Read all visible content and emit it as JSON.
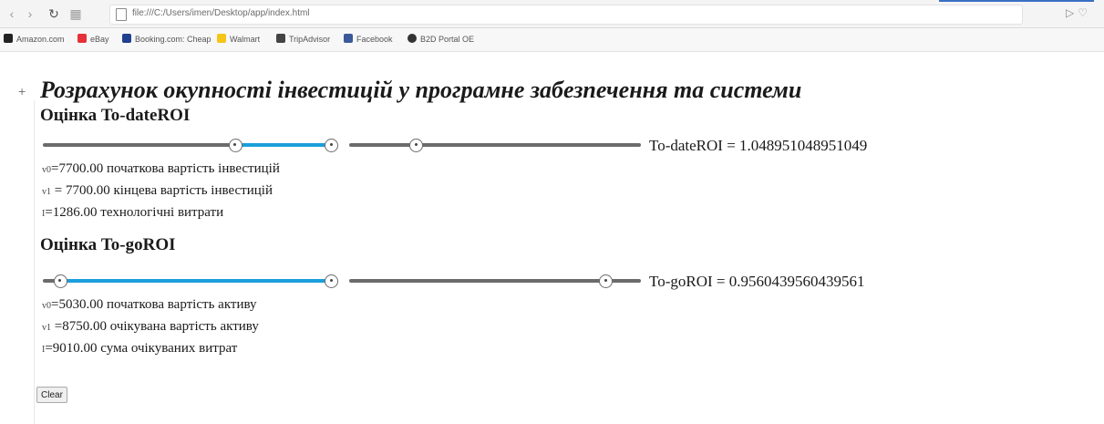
{
  "browser": {
    "url": "file:///C:/Users/imen/Desktop/app/index.html",
    "bookmarks": [
      {
        "label": "Amazon.com",
        "icon": "amazon-icon",
        "color": "#222222"
      },
      {
        "label": "eBay",
        "icon": "ebay-icon",
        "color": "#e53238"
      },
      {
        "label": "Booking.com: Cheap",
        "icon": "booking-icon",
        "color": "#1f3f8f"
      },
      {
        "label": "Walmart",
        "icon": "walmart-icon",
        "color": "#f5c518"
      },
      {
        "label": "TripAdvisor",
        "icon": "tripadvisor-icon",
        "color": "#444444"
      },
      {
        "label": "Facebook",
        "icon": "facebook-icon",
        "color": "#3b5998"
      },
      {
        "label": "B2D Portal OE",
        "icon": "portal-icon",
        "color": "#333333"
      }
    ]
  },
  "page": {
    "title": "Розрахунок окупності інвестицій у програмне забезпечення та системи",
    "accent_color": "#1a9fdb",
    "track_color": "#6b6b6b"
  },
  "todate": {
    "heading": "Оцінка To-dateROI",
    "result_label": "To-dateROI = 1.048951048951049",
    "range_slider": {
      "low_fraction": 0.66,
      "high_fraction": 0.99
    },
    "cost_slider": {
      "fraction": 0.23
    },
    "params": [
      {
        "symbol": "v0",
        "text": "=7700.00 початкова вартість інвестицій"
      },
      {
        "symbol": "v1",
        "text": " = 7700.00 кінцева вартість інвестицій"
      },
      {
        "symbol": "I",
        "text": "=1286.00 технологічні витрати"
      }
    ]
  },
  "togo": {
    "heading": "Оцінка To-goROI",
    "result_label": "To-goROI = 0.9560439560439561",
    "range_slider": {
      "low_fraction": 0.06,
      "high_fraction": 0.99
    },
    "cost_slider": {
      "fraction": 0.88
    },
    "params": [
      {
        "symbol": "v0",
        "text": "=5030.00 початкова вартість активу"
      },
      {
        "symbol": "v1",
        "text": " =8750.00 очікувана вартість активу"
      },
      {
        "symbol": "I",
        "text": "=9010.00 сума очікуваних витрат"
      }
    ]
  },
  "actions": {
    "clear_label": "Clear"
  }
}
